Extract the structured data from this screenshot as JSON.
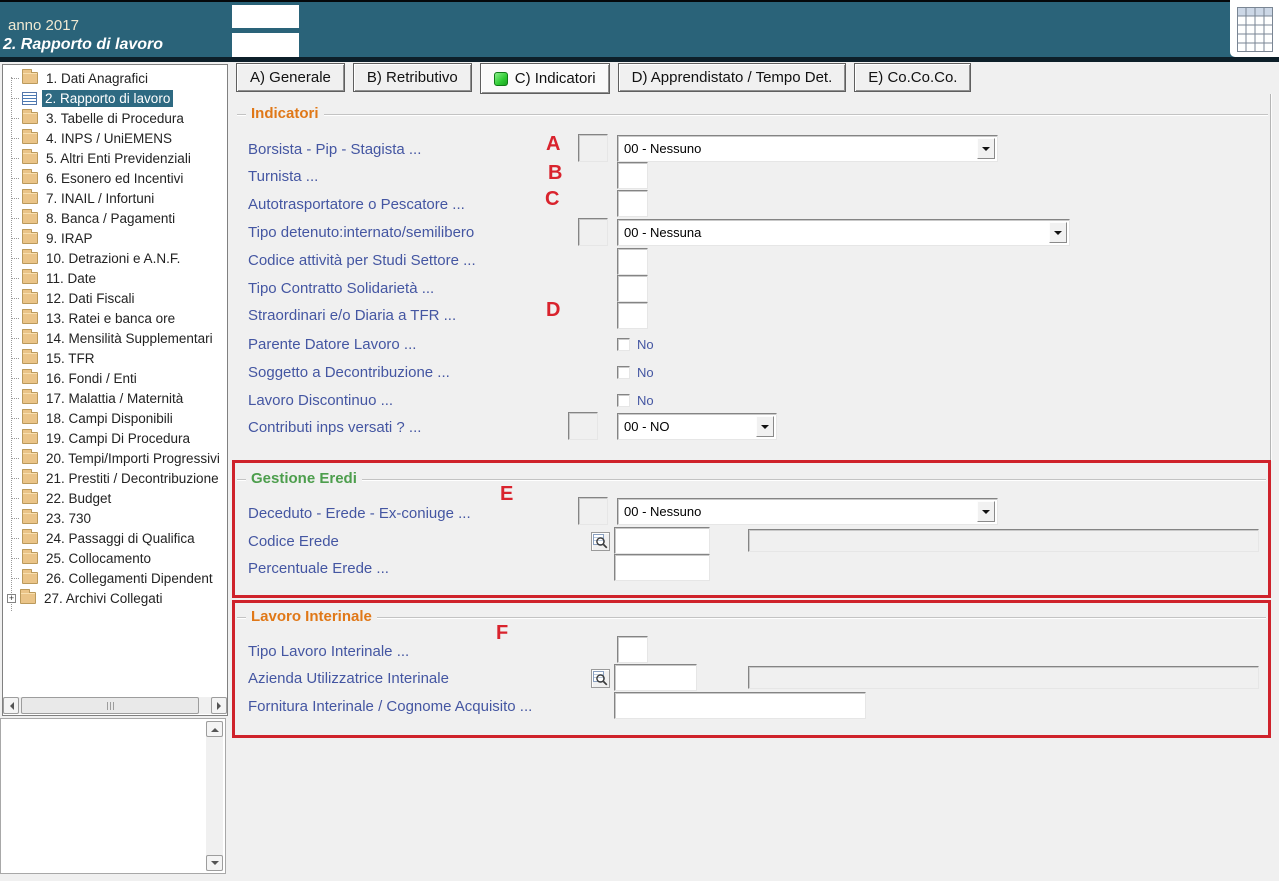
{
  "window": {
    "title_line1": "anno 2017",
    "title_line2": "2. Rapporto di lavoro"
  },
  "header": {
    "field1_value": "",
    "field2_value": ""
  },
  "tabs": [
    {
      "label": "A) Generale",
      "active": false
    },
    {
      "label": "B) Retributivo",
      "active": false
    },
    {
      "label": "C) Indicatori",
      "active": true
    },
    {
      "label": "D) Apprendistato / Tempo Det.",
      "active": false
    },
    {
      "label": "E) Co.Co.Co.",
      "active": false
    }
  ],
  "tree": {
    "items": [
      "1. Dati Anagrafici",
      "2. Rapporto di lavoro",
      "3. Tabelle di Procedura",
      "4. INPS / UniEMENS",
      "5. Altri Enti Previdenziali",
      "6. Esonero ed Incentivi",
      "7. INAIL / Infortuni",
      "8. Banca / Pagamenti",
      "9. IRAP",
      "10. Detrazioni e A.N.F.",
      "11. Date",
      "12. Dati Fiscali",
      "13. Ratei e banca ore",
      "14. Mensilità Supplementari",
      "15. TFR",
      "16. Fondi / Enti",
      "17. Malattia / Maternità",
      "18. Campi Disponibili",
      "19. Campi Di Procedura",
      "20. Tempi/Importi Progressivi",
      "21. Prestiti / Decontribuzione",
      "22. Budget",
      "23. 730",
      "24. Passaggi di Qualifica",
      "25. Collocamento",
      "26. Collegamenti Dipendent",
      "27. Archivi Collegati"
    ],
    "selected_index": 1,
    "last_item_expandable": true
  },
  "form": {
    "indicatori": {
      "title": "Indicatori",
      "borsista": {
        "label": "Borsista - Pip - Stagista ...",
        "annotation": "A",
        "prefix": "",
        "value": "00 - Nessuno"
      },
      "turnista": {
        "label": "Turnista ...",
        "annotation": "B",
        "value": ""
      },
      "autotrasportatore": {
        "label": "Autotrasportatore o Pescatore ...",
        "annotation": "C",
        "value": ""
      },
      "tipo_detenuto": {
        "label": "Tipo detenuto:internato/semilibero",
        "prefix": "",
        "value": "00 - Nessuna"
      },
      "codice_attivita": {
        "label": "Codice attività per Studi Settore ...",
        "value": ""
      },
      "tipo_contratto": {
        "label": "Tipo Contratto Solidarietà ...",
        "value": ""
      },
      "straordinari": {
        "label": "Straordinari e/o Diaria a TFR ...",
        "annotation": "D",
        "value": ""
      },
      "parente": {
        "label": "Parente Datore Lavoro ...",
        "checkbox_label": "No",
        "checked": false
      },
      "soggetto": {
        "label": "Soggetto a Decontribuzione ...",
        "checkbox_label": "No",
        "checked": false
      },
      "lavoro_discontinuo": {
        "label": "Lavoro Discontinuo ...",
        "checkbox_label": "No",
        "checked": false
      },
      "contributi": {
        "label": "Contributi inps versati ? ...",
        "prefix": "",
        "value": "00 - NO"
      }
    },
    "gestione_eredi": {
      "title": "Gestione Eredi",
      "annotation": "E",
      "deceduto": {
        "label": "Deceduto - Erede - Ex-coniuge ...",
        "prefix": "",
        "value": "00 - Nessuno"
      },
      "codice_erede": {
        "label": "Codice Erede",
        "value": "",
        "readonly_value": ""
      },
      "percentuale": {
        "label": "Percentuale Erede ...",
        "value": ""
      }
    },
    "lavoro_interinale": {
      "title": "Lavoro Interinale",
      "annotation": "F",
      "tipo": {
        "label": "Tipo Lavoro Interinale ...",
        "value": ""
      },
      "azienda": {
        "label": "Azienda Utilizzatrice Interinale",
        "value": "",
        "readonly_value": ""
      },
      "fornitura": {
        "label": "Fornitura Interinale / Cognome Acquisito ...",
        "value": ""
      }
    }
  },
  "colors": {
    "header_teal": "#2a6379",
    "selected_teal": "#2e6a82",
    "accent_orange": "#e07818",
    "accent_green": "#4d9e4d",
    "annotation_red": "#d9232d",
    "label_blue": "#4456a2"
  }
}
